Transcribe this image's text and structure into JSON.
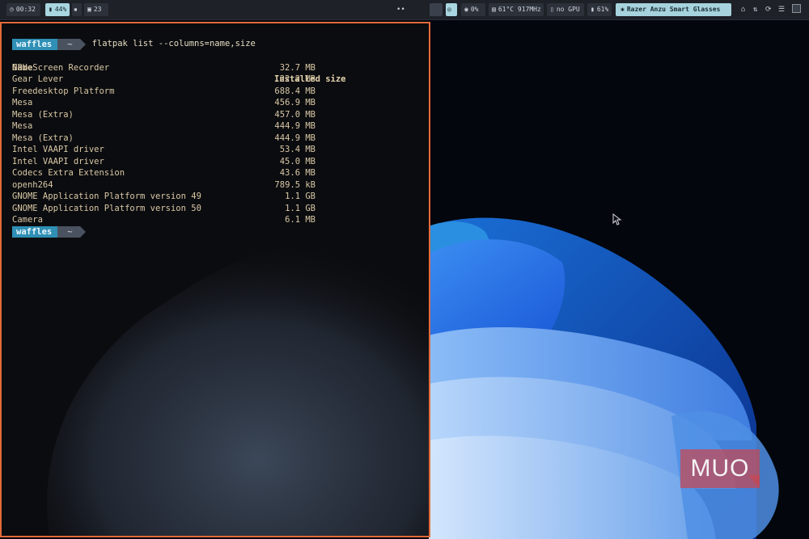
{
  "topbar": {
    "clock": "00:32",
    "battery": "44%",
    "workspace": "23",
    "net_speed": "0%",
    "cpu": "61°C 917MHz",
    "gpu": "no GPU",
    "disk": "61%",
    "bluetooth_device": "Razer Anzu Smart Glasses",
    "colors": {
      "bar": "#1e2128",
      "highlight": "#a9d6e0"
    }
  },
  "terminal": {
    "prompt_user": "waffles",
    "prompt_dir": "~",
    "command": "flatpak list --columns=name,size",
    "headers": {
      "name": "Name",
      "size": "Installed size"
    },
    "rows": [
      {
        "name": "GPU Screen Recorder",
        "size": "32.7 MB"
      },
      {
        "name": "Gear Lever",
        "size": "22.2 MB"
      },
      {
        "name": "Freedesktop Platform",
        "size": "688.4 MB"
      },
      {
        "name": "Mesa",
        "size": "456.9 MB"
      },
      {
        "name": "Mesa (Extra)",
        "size": "457.0 MB"
      },
      {
        "name": "Mesa",
        "size": "444.9 MB"
      },
      {
        "name": "Mesa (Extra)",
        "size": "444.9 MB"
      },
      {
        "name": "Intel VAAPI driver",
        "size": "53.4 MB"
      },
      {
        "name": "Intel VAAPI driver",
        "size": "45.0 MB"
      },
      {
        "name": "Codecs Extra Extension",
        "size": "43.6 MB"
      },
      {
        "name": "openh264",
        "size": "789.5 kB"
      },
      {
        "name": "GNOME Application Platform version 49",
        "size": "1.1 GB"
      },
      {
        "name": "GNOME Application Platform version 50",
        "size": "1.1 GB"
      },
      {
        "name": "Camera",
        "size": "6.1 MB"
      }
    ],
    "colors": {
      "border": "#e26a3a",
      "user_badge": "#2f8fb5",
      "text": "#d9c8a6"
    }
  },
  "watermark": {
    "text": "MUO",
    "color": "#c84650"
  }
}
